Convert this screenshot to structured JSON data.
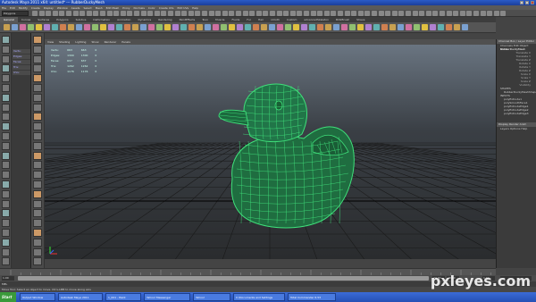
{
  "titlebar": {
    "title": "Autodesk Maya 2011 x64: untitled* --- RubberDuckyMesh"
  },
  "menubar": {
    "items": [
      "File",
      "Edit",
      "Modify",
      "Create",
      "Display",
      "Window",
      "Assets",
      "Select",
      "Mesh",
      "Edit Mesh",
      "Proxy",
      "Normals",
      "Color",
      "Create UVs",
      "Edit UVs",
      "Help"
    ]
  },
  "statusline": {
    "mode": "Polygons"
  },
  "shelftabs": {
    "items": [
      "General",
      "Curves",
      "Surfaces",
      "Polygons",
      "Subdivs",
      "Deformation",
      "Animation",
      "Dynamics",
      "Rendering",
      "PaintEffects",
      "Toon",
      "Muscle",
      "Fluids",
      "Fur",
      "Hair",
      "nCloth",
      "Custom",
      "advancedSkeleton",
      "BlitzBrush",
      "Shave"
    ]
  },
  "panelmenu": {
    "items": [
      "View",
      "Shading",
      "Lighting",
      "Show",
      "Renderer",
      "Panels"
    ]
  },
  "hud": {
    "rows": [
      {
        "label": "Verts:",
        "a": "663",
        "b": "663",
        "c": "0"
      },
      {
        "label": "Edges:",
        "a": "1300",
        "b": "1300",
        "c": "0"
      },
      {
        "label": "Faces:",
        "a": "637",
        "b": "637",
        "c": "0"
      },
      {
        "label": "Tris:",
        "a": "1262",
        "b": "1262",
        "c": "0"
      },
      {
        "label": "UVs:",
        "a": "1176",
        "b": "1176",
        "c": "0"
      }
    ]
  },
  "outliner": {
    "items": [
      "Verts:",
      "Edges:",
      "Faces:",
      "Tris:",
      "UVs:"
    ]
  },
  "channelbox": {
    "header": "Channel Box / Layer Editor",
    "tabs": "Channels  Edit  Object  Show",
    "object": "RubberDuckyMesh",
    "attributes": [
      "Translate X",
      "Translate Y",
      "Translate Z",
      "Rotate X",
      "Rotate Y",
      "Rotate Z",
      "Scale X",
      "Scale Y",
      "Scale Z",
      "Visibility"
    ],
    "shapes_label": "SHAPES",
    "shapes": [
      "RubberDuckyMeshShape"
    ],
    "inputs_label": "INPUTS",
    "inputs": [
      "polyExtrude1",
      "polySmoothFace1",
      "polyExtrudeEdge1",
      "polyExtrudeEdge2",
      "polyExtrudeEdge3"
    ],
    "layer_tabs": "Display  Render  Anim",
    "layer_menu": "Layers  Options  Help"
  },
  "timeslider": {
    "start": "1.00",
    "end": "24.00",
    "range_end": "48.00",
    "current": "1.00"
  },
  "cmdline": {
    "label": "MEL"
  },
  "helpline": {
    "text": "Move Tool: Select an object to move. Ctrl+LMB to move along axis"
  },
  "taskbar": {
    "start": "Start",
    "tasks": [
      "Output Window",
      "Autodesk Maya 2011",
      "1_001 - Paint",
      "Yahoo! Messenger",
      "Yahoo!",
      "C:\\Documents and Settings",
      "Total Commander 6.53"
    ]
  },
  "watermark": {
    "text": "pxleyes.com"
  },
  "colors": {
    "wire": "#3fe07a",
    "mesh": "#1f7a45",
    "titlebar": "#2a5bc8"
  }
}
